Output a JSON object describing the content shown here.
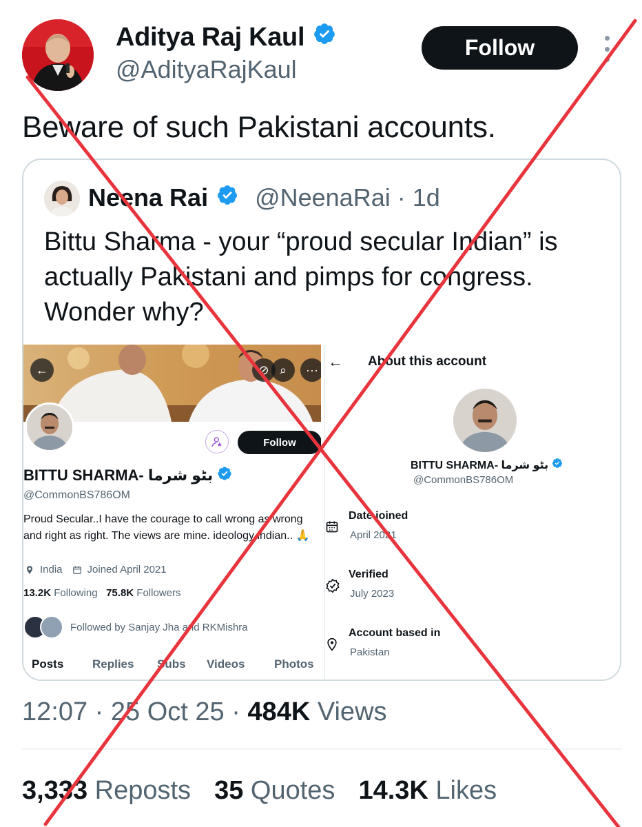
{
  "author": {
    "name": "Aditya Raj Kaul",
    "handle": "@AdityaRajKaul",
    "follow_label": "Follow"
  },
  "tweet": {
    "text": "Beware of such Pakistani accounts.",
    "time": "12:07",
    "sep1": "·",
    "date": "25 Oct 25",
    "sep2": "·",
    "views_count": "484K",
    "views_label": "Views"
  },
  "quote": {
    "name": "Neena Rai",
    "handle_time": "@NeenaRai · 1d",
    "text": "Bittu Sharma - your “proud secular Indian” is actually Pakistani and pimps for congress. Wonder why?"
  },
  "profile_screenshot": {
    "follow_label": "Follow",
    "name": "BITTU SHARMA- بٹو شرما",
    "handle": "@CommonBS786OM",
    "bio": "Proud Secular..I have the courage to call wrong as wrong and right as right. The views are mine. ideology indian.. 🙏",
    "location": "India",
    "joined": "Joined April 2021",
    "following_count": "13.2K",
    "following_label": "Following",
    "followers_count": "75.8K",
    "followers_label": "Followers",
    "followed_by": "Followed by Sanjay Jha and RKMishra",
    "tabs": [
      "Posts",
      "Replies",
      "Subs",
      "Videos",
      "Photos"
    ]
  },
  "about_screenshot": {
    "title": "About this account",
    "name": "BITTU SHARMA- بٹو شرما",
    "handle": "@CommonBS786OM",
    "rows": [
      {
        "label": "Date joined",
        "value": "April 2021"
      },
      {
        "label": "Verified",
        "value": "July 2023"
      },
      {
        "label": "Account based in",
        "value": "Pakistan"
      }
    ]
  },
  "stats": {
    "reposts_count": "3,333",
    "reposts_label": "Reposts",
    "quotes_count": "35",
    "quotes_label": "Quotes",
    "likes_count": "14.3K",
    "likes_label": "Likes"
  },
  "colors": {
    "verified_blue": "#1d9bf0",
    "cross_red": "#e8343c",
    "text_secondary": "#536471"
  }
}
